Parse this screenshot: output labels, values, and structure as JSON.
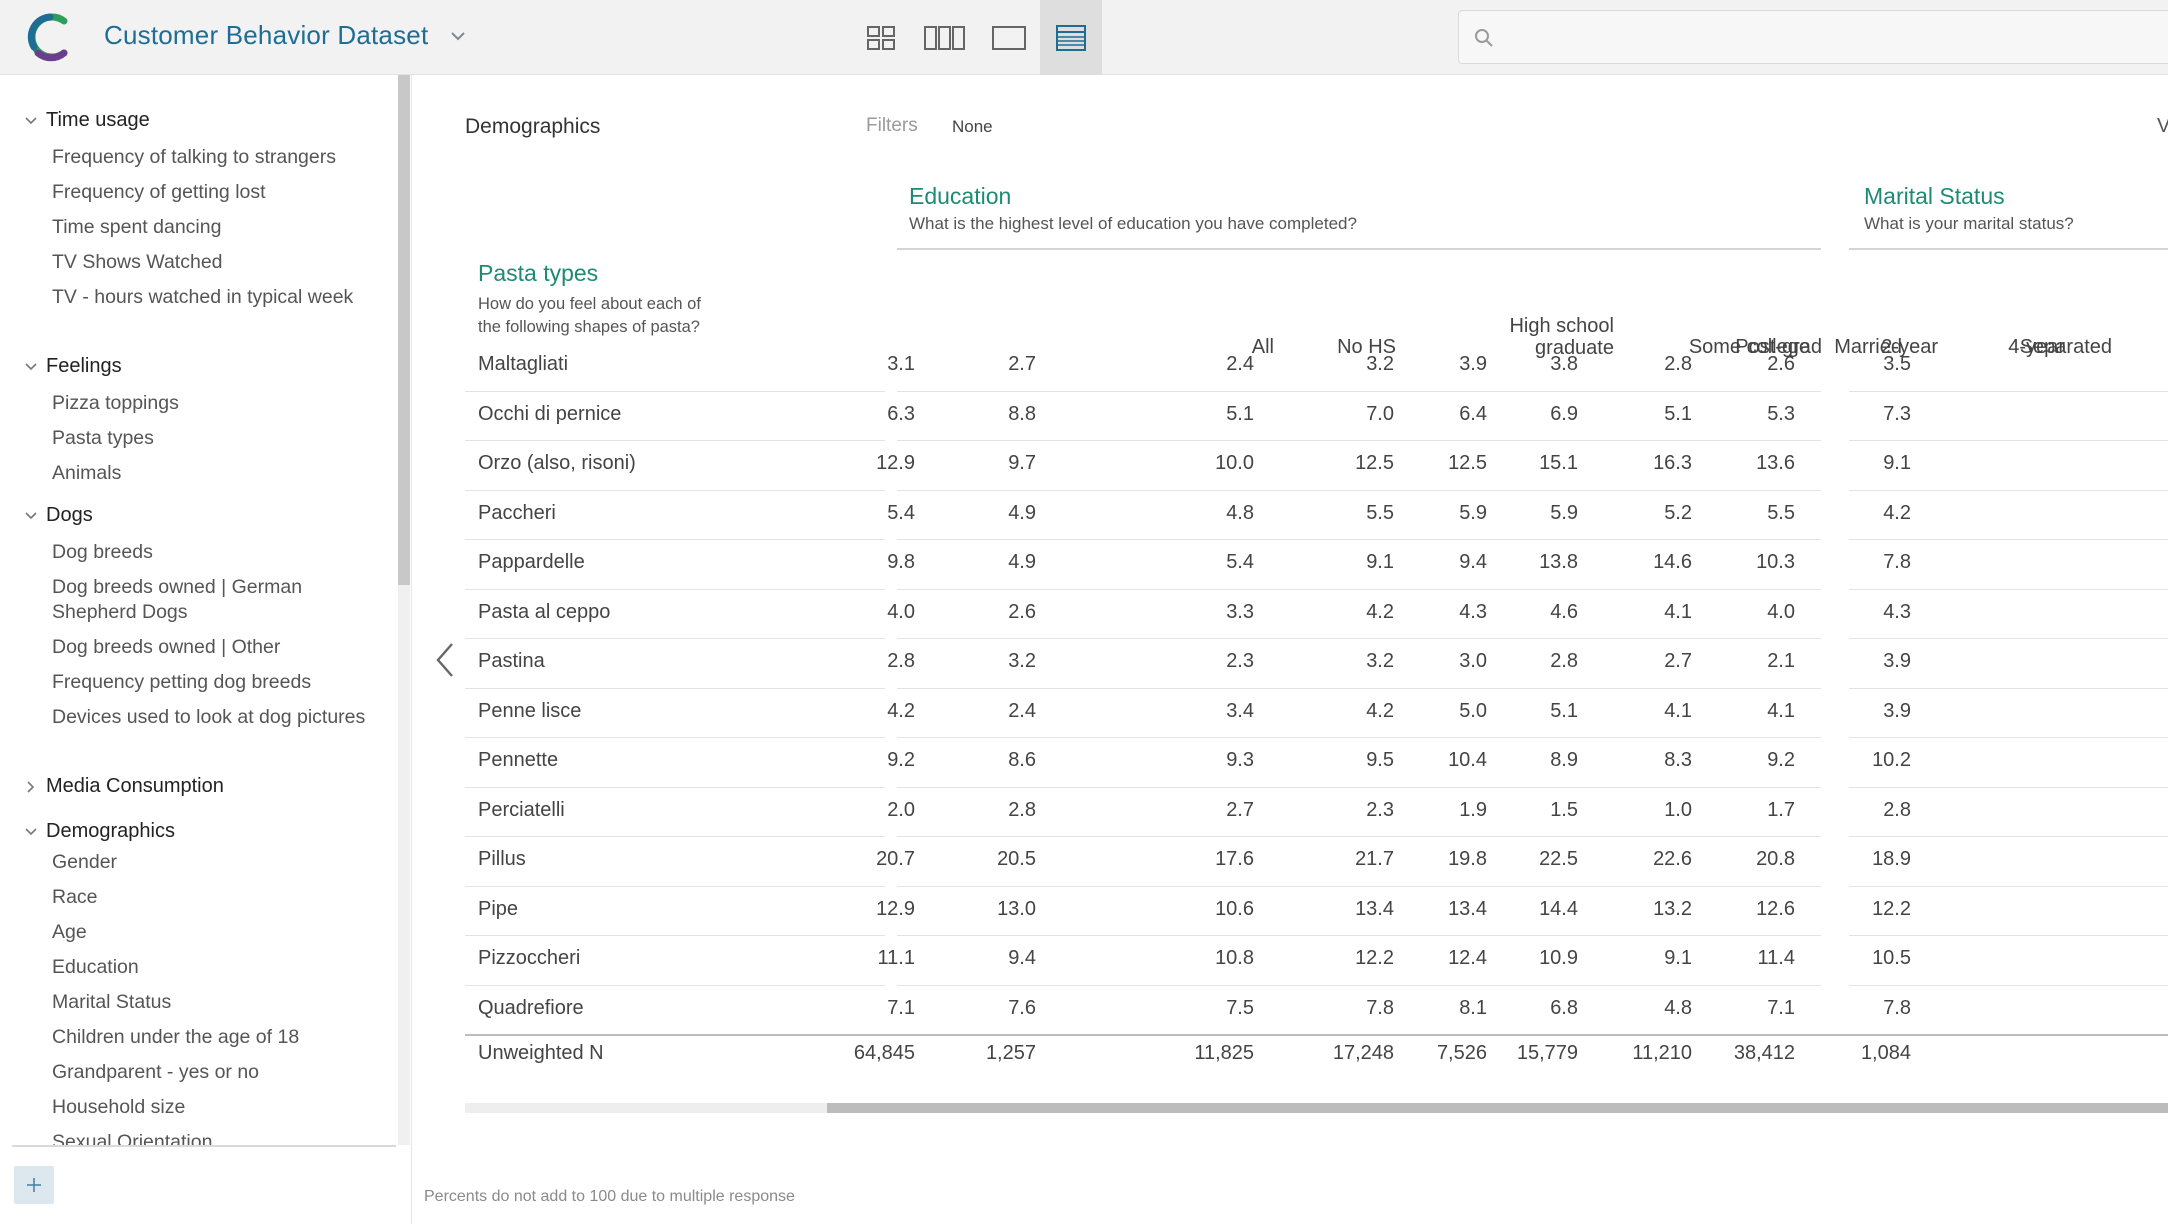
{
  "app": {
    "title": "Customer Behavior Dataset",
    "brand_colors": [
      "#1f6d94",
      "#2f9e5d",
      "#6a3d8f"
    ]
  },
  "toolbar": {
    "views": [
      "grid-2x2-view",
      "grid-3col-view",
      "single-view",
      "table-view"
    ],
    "active_view": "table-view"
  },
  "search": {
    "placeholder": ""
  },
  "sidebar": {
    "sections": [
      {
        "label": "Time usage",
        "expanded": true,
        "items": [
          "Frequency of talking to strangers",
          "Frequency of getting lost",
          "Time spent dancing",
          "TV Shows Watched",
          "TV - hours watched in typical week"
        ]
      },
      {
        "label": "Feelings",
        "expanded": true,
        "items": [
          "Pizza toppings",
          "Pasta types",
          "Animals"
        ]
      },
      {
        "label": "Dogs",
        "expanded": true,
        "items": [
          "Dog breeds",
          "Dog breeds owned | German Shepherd Dogs",
          "Dog breeds owned | Other",
          "Frequency petting dog breeds",
          "Devices used to look at dog pictures"
        ]
      },
      {
        "label": "Media Consumption",
        "expanded": false,
        "items": []
      },
      {
        "label": "Demographics",
        "expanded": true,
        "items": [
          "Gender",
          "Race",
          "Age",
          "Education",
          "Marital Status",
          "Children under the age of 18",
          "Grandparent - yes or no",
          "Household size",
          "Sexual Orientation"
        ]
      }
    ]
  },
  "main": {
    "title": "Demographics",
    "filters_label": "Filters",
    "filters_value": "None",
    "clipped_right_label": "V",
    "row_variable": {
      "title": "Pasta types",
      "question": "How do you feel about each of the following shapes of pasta?"
    },
    "groups": [
      {
        "title": "Education",
        "question": "What is the highest level of education you have completed?"
      },
      {
        "title": "Marital Status",
        "question": "What is your marital status?"
      }
    ],
    "columns": [
      "All",
      "No HS",
      "High school graduate",
      "Some college",
      "2-year",
      "4-year",
      "Post-grad",
      "Married",
      "Separated"
    ],
    "rows": [
      {
        "label": "Maltagliati",
        "values": [
          "3.1",
          "2.7",
          "2.4",
          "3.2",
          "3.9",
          "3.8",
          "2.8",
          "2.6",
          "3.5"
        ]
      },
      {
        "label": "Occhi di pernice",
        "values": [
          "6.3",
          "8.8",
          "5.1",
          "7.0",
          "6.4",
          "6.9",
          "5.1",
          "5.3",
          "7.3"
        ]
      },
      {
        "label": "Orzo (also, risoni)",
        "values": [
          "12.9",
          "9.7",
          "10.0",
          "12.5",
          "12.5",
          "15.1",
          "16.3",
          "13.6",
          "9.1"
        ]
      },
      {
        "label": "Paccheri",
        "values": [
          "5.4",
          "4.9",
          "4.8",
          "5.5",
          "5.9",
          "5.9",
          "5.2",
          "5.5",
          "4.2"
        ]
      },
      {
        "label": "Pappardelle",
        "values": [
          "9.8",
          "4.9",
          "5.4",
          "9.1",
          "9.4",
          "13.8",
          "14.6",
          "10.3",
          "7.8"
        ]
      },
      {
        "label": "Pasta al ceppo",
        "values": [
          "4.0",
          "2.6",
          "3.3",
          "4.2",
          "4.3",
          "4.6",
          "4.1",
          "4.0",
          "4.3"
        ]
      },
      {
        "label": "Pastina",
        "values": [
          "2.8",
          "3.2",
          "2.3",
          "3.2",
          "3.0",
          "2.8",
          "2.7",
          "2.1",
          "3.9"
        ]
      },
      {
        "label": "Penne lisce",
        "values": [
          "4.2",
          "2.4",
          "3.4",
          "4.2",
          "5.0",
          "5.1",
          "4.1",
          "4.1",
          "3.9"
        ]
      },
      {
        "label": "Pennette",
        "values": [
          "9.2",
          "8.6",
          "9.3",
          "9.5",
          "10.4",
          "8.9",
          "8.3",
          "9.2",
          "10.2"
        ]
      },
      {
        "label": "Perciatelli",
        "values": [
          "2.0",
          "2.8",
          "2.7",
          "2.3",
          "1.9",
          "1.5",
          "1.0",
          "1.7",
          "2.8"
        ]
      },
      {
        "label": "Pillus",
        "values": [
          "20.7",
          "20.5",
          "17.6",
          "21.7",
          "19.8",
          "22.5",
          "22.6",
          "20.8",
          "18.9"
        ]
      },
      {
        "label": "Pipe",
        "values": [
          "12.9",
          "13.0",
          "10.6",
          "13.4",
          "13.4",
          "14.4",
          "13.2",
          "12.6",
          "12.2"
        ]
      },
      {
        "label": "Pizzoccheri",
        "values": [
          "11.1",
          "9.4",
          "10.8",
          "12.2",
          "12.4",
          "10.9",
          "9.1",
          "11.4",
          "10.5"
        ]
      },
      {
        "label": "Quadrefiore",
        "values": [
          "7.1",
          "7.6",
          "7.5",
          "7.8",
          "8.1",
          "6.8",
          "4.8",
          "7.1",
          "7.8"
        ]
      }
    ],
    "unweighted": {
      "label": "Unweighted N",
      "values": [
        "64,845",
        "1,257",
        "11,825",
        "17,248",
        "7,526",
        "15,779",
        "11,210",
        "38,412",
        "1,084"
      ]
    },
    "footnote": "Percents do not add to 100 due to multiple response"
  }
}
